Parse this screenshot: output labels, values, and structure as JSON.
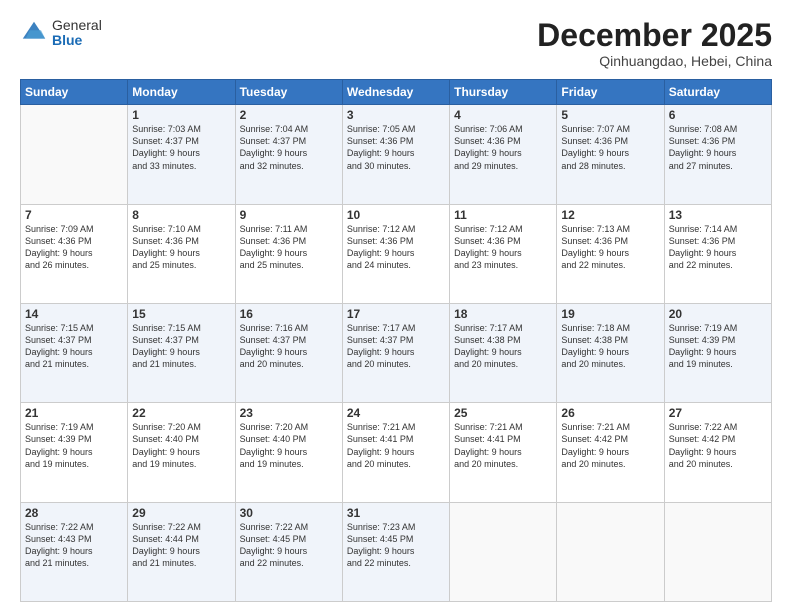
{
  "header": {
    "logo_general": "General",
    "logo_blue": "Blue",
    "month_title": "December 2025",
    "subtitle": "Qinhuangdao, Hebei, China"
  },
  "days_of_week": [
    "Sunday",
    "Monday",
    "Tuesday",
    "Wednesday",
    "Thursday",
    "Friday",
    "Saturday"
  ],
  "weeks": [
    [
      {
        "num": "",
        "info": ""
      },
      {
        "num": "1",
        "info": "Sunrise: 7:03 AM\nSunset: 4:37 PM\nDaylight: 9 hours\nand 33 minutes."
      },
      {
        "num": "2",
        "info": "Sunrise: 7:04 AM\nSunset: 4:37 PM\nDaylight: 9 hours\nand 32 minutes."
      },
      {
        "num": "3",
        "info": "Sunrise: 7:05 AM\nSunset: 4:36 PM\nDaylight: 9 hours\nand 30 minutes."
      },
      {
        "num": "4",
        "info": "Sunrise: 7:06 AM\nSunset: 4:36 PM\nDaylight: 9 hours\nand 29 minutes."
      },
      {
        "num": "5",
        "info": "Sunrise: 7:07 AM\nSunset: 4:36 PM\nDaylight: 9 hours\nand 28 minutes."
      },
      {
        "num": "6",
        "info": "Sunrise: 7:08 AM\nSunset: 4:36 PM\nDaylight: 9 hours\nand 27 minutes."
      }
    ],
    [
      {
        "num": "7",
        "info": "Sunrise: 7:09 AM\nSunset: 4:36 PM\nDaylight: 9 hours\nand 26 minutes."
      },
      {
        "num": "8",
        "info": "Sunrise: 7:10 AM\nSunset: 4:36 PM\nDaylight: 9 hours\nand 25 minutes."
      },
      {
        "num": "9",
        "info": "Sunrise: 7:11 AM\nSunset: 4:36 PM\nDaylight: 9 hours\nand 25 minutes."
      },
      {
        "num": "10",
        "info": "Sunrise: 7:12 AM\nSunset: 4:36 PM\nDaylight: 9 hours\nand 24 minutes."
      },
      {
        "num": "11",
        "info": "Sunrise: 7:12 AM\nSunset: 4:36 PM\nDaylight: 9 hours\nand 23 minutes."
      },
      {
        "num": "12",
        "info": "Sunrise: 7:13 AM\nSunset: 4:36 PM\nDaylight: 9 hours\nand 22 minutes."
      },
      {
        "num": "13",
        "info": "Sunrise: 7:14 AM\nSunset: 4:36 PM\nDaylight: 9 hours\nand 22 minutes."
      }
    ],
    [
      {
        "num": "14",
        "info": "Sunrise: 7:15 AM\nSunset: 4:37 PM\nDaylight: 9 hours\nand 21 minutes."
      },
      {
        "num": "15",
        "info": "Sunrise: 7:15 AM\nSunset: 4:37 PM\nDaylight: 9 hours\nand 21 minutes."
      },
      {
        "num": "16",
        "info": "Sunrise: 7:16 AM\nSunset: 4:37 PM\nDaylight: 9 hours\nand 20 minutes."
      },
      {
        "num": "17",
        "info": "Sunrise: 7:17 AM\nSunset: 4:37 PM\nDaylight: 9 hours\nand 20 minutes."
      },
      {
        "num": "18",
        "info": "Sunrise: 7:17 AM\nSunset: 4:38 PM\nDaylight: 9 hours\nand 20 minutes."
      },
      {
        "num": "19",
        "info": "Sunrise: 7:18 AM\nSunset: 4:38 PM\nDaylight: 9 hours\nand 20 minutes."
      },
      {
        "num": "20",
        "info": "Sunrise: 7:19 AM\nSunset: 4:39 PM\nDaylight: 9 hours\nand 19 minutes."
      }
    ],
    [
      {
        "num": "21",
        "info": "Sunrise: 7:19 AM\nSunset: 4:39 PM\nDaylight: 9 hours\nand 19 minutes."
      },
      {
        "num": "22",
        "info": "Sunrise: 7:20 AM\nSunset: 4:40 PM\nDaylight: 9 hours\nand 19 minutes."
      },
      {
        "num": "23",
        "info": "Sunrise: 7:20 AM\nSunset: 4:40 PM\nDaylight: 9 hours\nand 19 minutes."
      },
      {
        "num": "24",
        "info": "Sunrise: 7:21 AM\nSunset: 4:41 PM\nDaylight: 9 hours\nand 20 minutes."
      },
      {
        "num": "25",
        "info": "Sunrise: 7:21 AM\nSunset: 4:41 PM\nDaylight: 9 hours\nand 20 minutes."
      },
      {
        "num": "26",
        "info": "Sunrise: 7:21 AM\nSunset: 4:42 PM\nDaylight: 9 hours\nand 20 minutes."
      },
      {
        "num": "27",
        "info": "Sunrise: 7:22 AM\nSunset: 4:42 PM\nDaylight: 9 hours\nand 20 minutes."
      }
    ],
    [
      {
        "num": "28",
        "info": "Sunrise: 7:22 AM\nSunset: 4:43 PM\nDaylight: 9 hours\nand 21 minutes."
      },
      {
        "num": "29",
        "info": "Sunrise: 7:22 AM\nSunset: 4:44 PM\nDaylight: 9 hours\nand 21 minutes."
      },
      {
        "num": "30",
        "info": "Sunrise: 7:22 AM\nSunset: 4:45 PM\nDaylight: 9 hours\nand 22 minutes."
      },
      {
        "num": "31",
        "info": "Sunrise: 7:23 AM\nSunset: 4:45 PM\nDaylight: 9 hours\nand 22 minutes."
      },
      {
        "num": "",
        "info": ""
      },
      {
        "num": "",
        "info": ""
      },
      {
        "num": "",
        "info": ""
      }
    ]
  ]
}
